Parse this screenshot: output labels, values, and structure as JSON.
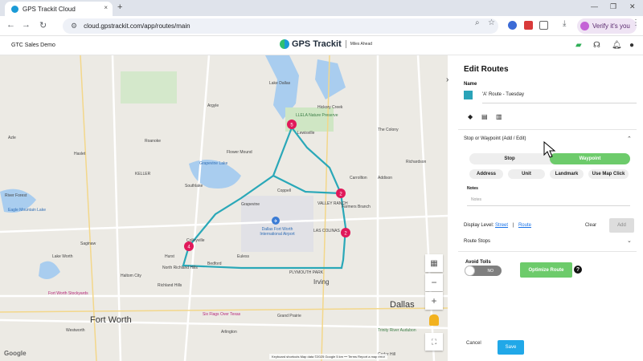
{
  "browser": {
    "tab_title": "GPS Trackit Cloud",
    "tab_close": "×",
    "new_tab": "+",
    "url": "cloud.gpstrackit.com/app/routes/main",
    "profile_label": "Verify it's you",
    "window_controls": [
      "—",
      "❐",
      "✕"
    ]
  },
  "app": {
    "company": "GTC Sales Demo",
    "brand": "GPS Trackit",
    "tagline": "Miles Ahead"
  },
  "map": {
    "labels": [
      {
        "text": "Lake Dallas",
        "cls": ""
      },
      {
        "text": "Hickory Creek",
        "cls": ""
      },
      {
        "text": "Lewisville",
        "cls": ""
      },
      {
        "text": "The Colony",
        "cls": ""
      },
      {
        "text": "LLELA Nature Preserve",
        "cls": "park"
      },
      {
        "text": "Flower Mound",
        "cls": ""
      },
      {
        "text": "Grapevine Lake",
        "cls": "blue"
      },
      {
        "text": "Coppell",
        "cls": ""
      },
      {
        "text": "VALLEY RANCH",
        "cls": ""
      },
      {
        "text": "Farmers Branch",
        "cls": ""
      },
      {
        "text": "Grapevine",
        "cls": ""
      },
      {
        "text": "Dallas Fort Worth International Airport",
        "cls": "blue"
      },
      {
        "text": "Colleyville",
        "cls": ""
      },
      {
        "text": "Bedford",
        "cls": ""
      },
      {
        "text": "Irving",
        "cls": "mid"
      },
      {
        "text": "Dallas",
        "cls": "big"
      },
      {
        "text": "Fort Worth",
        "cls": "big"
      },
      {
        "text": "Arlington",
        "cls": ""
      },
      {
        "text": "North Richland Hills",
        "cls": ""
      },
      {
        "text": "Haltom City",
        "cls": ""
      },
      {
        "text": "Richland Hills",
        "cls": ""
      },
      {
        "text": "Fort Worth Stockyards",
        "cls": "pink"
      },
      {
        "text": "Six Flags Over Texas",
        "cls": "pink"
      },
      {
        "text": "Eagle Mountain Lake",
        "cls": "blue"
      },
      {
        "text": "Saginaw",
        "cls": ""
      },
      {
        "text": "KELLER",
        "cls": ""
      },
      {
        "text": "Southlake",
        "cls": ""
      },
      {
        "text": "Euless",
        "cls": ""
      },
      {
        "text": "Hurst",
        "cls": ""
      },
      {
        "text": "Grand Prairie",
        "cls": ""
      },
      {
        "text": "LAS COLINAS",
        "cls": ""
      },
      {
        "text": "Carrollton",
        "cls": ""
      },
      {
        "text": "Addison",
        "cls": ""
      },
      {
        "text": "Richardson",
        "cls": ""
      },
      {
        "text": "PLYMOUTH PARK",
        "cls": ""
      },
      {
        "text": "Trinity River Audubon",
        "cls": "park"
      },
      {
        "text": "Cedar Hill",
        "cls": ""
      },
      {
        "text": "River Forest",
        "cls": ""
      },
      {
        "text": "Lake Worth",
        "cls": ""
      },
      {
        "text": "Azle",
        "cls": ""
      },
      {
        "text": "Haslet",
        "cls": ""
      },
      {
        "text": "Roanoke",
        "cls": ""
      },
      {
        "text": "Argyle",
        "cls": ""
      },
      {
        "text": "Westworth",
        "cls": ""
      }
    ],
    "stops": [
      {
        "label": "5"
      },
      {
        "label": "2"
      },
      {
        "label": "2"
      },
      {
        "label": "4"
      }
    ],
    "zoom_in": "+",
    "zoom_out": "−",
    "attribution": "Keyboard shortcuts   Map data ©2025 Google   5 km ⎯⎯   Terms   Report a map error",
    "google_logo": "Google"
  },
  "panel": {
    "title": "Edit Routes",
    "name_label": "Name",
    "route_color": "#2aa3b8",
    "route_name": "'A' Route - Tuesday",
    "tools": [
      "directions-icon",
      "print-icon",
      "document-icon"
    ],
    "stop_section": "Stop or Waypoint (Add / Edit)",
    "segment": {
      "stop": "Stop",
      "waypoint": "Waypoint"
    },
    "input_modes": [
      "Address",
      "Unit",
      "Landmark",
      "Use Map Click"
    ],
    "notes_label": "Notes",
    "notes_placeholder": "Notes",
    "display_level_label": "Display Level:",
    "display_street": "Street",
    "display_divider": "|",
    "display_route": "Route",
    "clear": "Clear",
    "add": "Add",
    "route_stops": "Route Stops",
    "avoid_tolls": "Avoid Tolls",
    "toggle_text": "NO",
    "optimize": "Optimize Route",
    "help": "?",
    "cancel": "Cancel",
    "save": "Save",
    "accent_green": "#6dcb6b",
    "accent_blue": "#21a8e8"
  }
}
